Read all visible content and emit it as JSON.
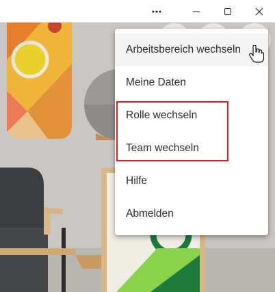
{
  "window": {
    "more_icon": "more-horizontal-icon",
    "minimize_icon": "minimize-icon",
    "maximize_icon": "maximize-icon",
    "close_icon": "close-icon"
  },
  "menu": {
    "items": [
      {
        "label": "Arbeitsbereich wechseln"
      },
      {
        "label": "Meine Daten"
      },
      {
        "label": "Rolle wechseln"
      },
      {
        "label": "Team wechseln"
      },
      {
        "label": "Hilfe"
      },
      {
        "label": "Abmelden"
      }
    ],
    "highlight_color": "#d42323"
  }
}
